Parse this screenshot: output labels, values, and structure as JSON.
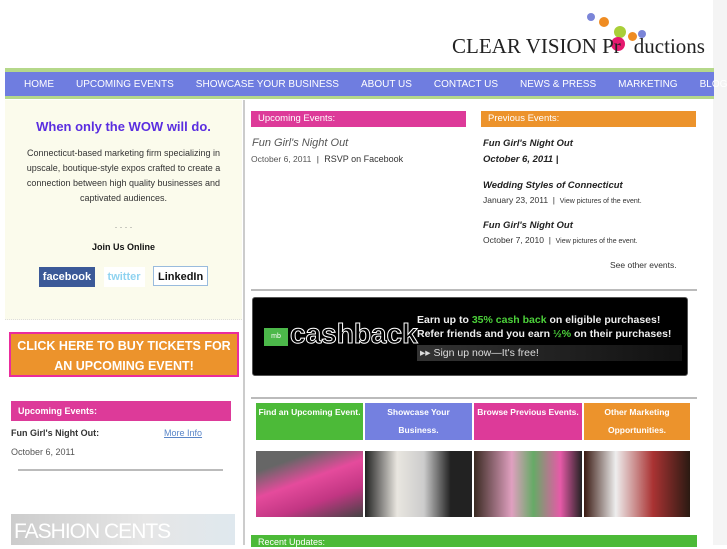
{
  "header": {
    "logo_text": "CLEAR VISION Productions",
    "logo_part1": "CLEAR VISION Pr",
    "logo_part2": "ductions"
  },
  "nav": [
    "HOME",
    "UPCOMING EVENTS",
    "SHOWCASE YOUR BUSINESS",
    "ABOUT US",
    "CONTACT US",
    "NEWS & PRESS",
    "MARKETING",
    "BLOG"
  ],
  "sidebar": {
    "tagline": "When only the WOW will do.",
    "description": "Connecticut-based marketing firm specializing in upscale, boutique-style expos crafted to create a connection between high quality businesses and captivated audiences.",
    "dots": ". . . .",
    "join_label": "Join Us Online",
    "social": [
      "facebook",
      "twitter",
      "LinkedIn"
    ],
    "tickets_button": "CLICK HERE TO BUY TICKETS FOR AN UPCOMING EVENT!",
    "upcoming_header": "Upcoming Events:",
    "event_name": "Fun Girl's Night Out:",
    "more_info": "More Info",
    "event_date": "October 6, 2011",
    "ad_text": "FASHION CENTS"
  },
  "upcoming": {
    "header": "Upcoming Events:",
    "title": "Fun Girl's Night Out",
    "date": "October 6, 2011",
    "sep": "|",
    "link": "RSVP on Facebook"
  },
  "previous": {
    "header": "Previous Events:",
    "events": [
      {
        "title": "Fun Girl's Night Out",
        "date": "October 6, 2011 |",
        "link": ""
      },
      {
        "title": "Wedding Styles of Connecticut",
        "date": "January 23, 2011",
        "link": "View pictures of the event."
      },
      {
        "title": "Fun Girl's Night Out",
        "date": "October 7, 2010",
        "link": "View pictures of the event."
      }
    ],
    "see_other": "See other events."
  },
  "banner": {
    "brand": "cashback",
    "badge": "mb",
    "line1a": "Earn up to ",
    "line1b": "35% cash back",
    "line1c": " on eligible purchases!",
    "line2a": "Refer friends and you earn ",
    "line2b": "½%",
    "line2c": " on their purchases!",
    "cta": "▸▸ Sign up now—It's free!"
  },
  "tiles": [
    "Find an Upcoming Event.",
    "Showcase Your Business.",
    "Browse Previous Events.",
    "Other Marketing Opportunities."
  ],
  "recent_updates": "Recent Updates:",
  "colors": {
    "nav": "#6f7de0",
    "pink": "#dd3a99",
    "orange": "#ec932c",
    "green": "#4cba38"
  }
}
